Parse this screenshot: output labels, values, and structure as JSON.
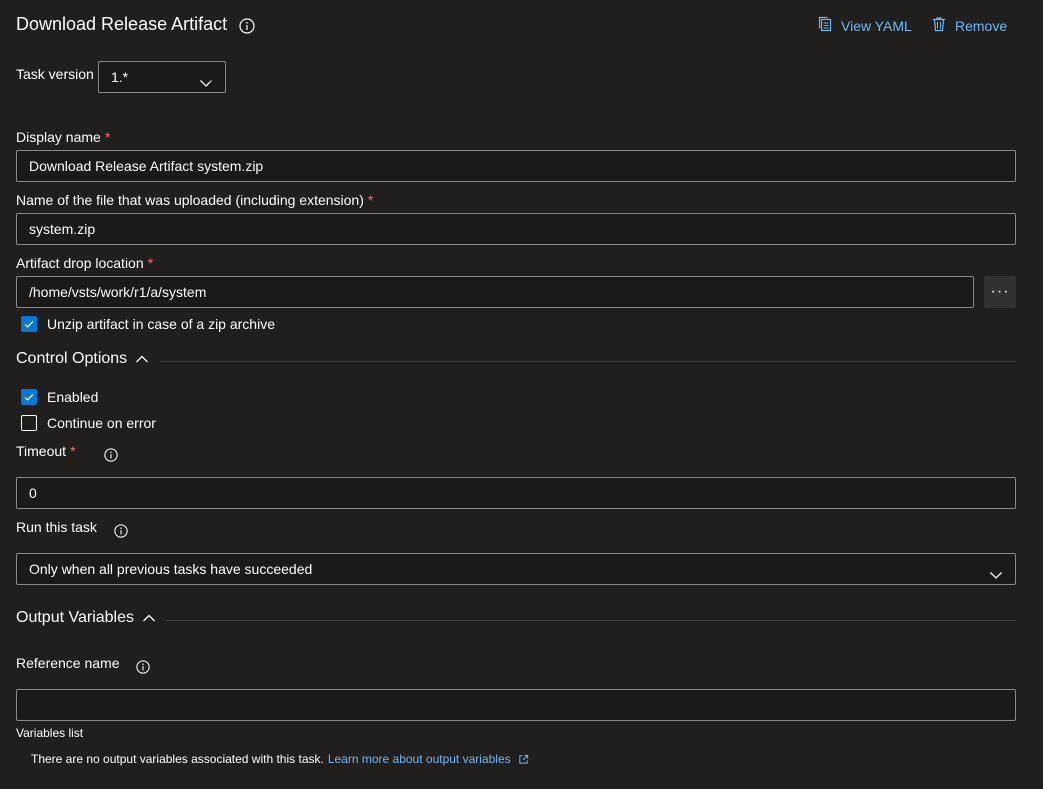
{
  "header": {
    "title": "Download Release Artifact",
    "view_yaml_label": "View YAML",
    "remove_label": "Remove"
  },
  "task_version": {
    "label": "Task version",
    "value": "1.*"
  },
  "display_name": {
    "label": "Display name",
    "required_mark": "*",
    "value": "Download Release Artifact system.zip"
  },
  "file_name": {
    "label": "Name of the file that was uploaded (including extension)",
    "required_mark": "*",
    "value": "system.zip"
  },
  "drop_location": {
    "label": "Artifact drop location",
    "required_mark": "*",
    "value": "/home/vsts/work/r1/a/system",
    "browse_label": "···"
  },
  "unzip": {
    "label": "Unzip artifact in case of a zip archive",
    "checked": true
  },
  "control_options": {
    "title": "Control Options",
    "enabled": {
      "label": "Enabled",
      "checked": true
    },
    "continue_on_error": {
      "label": "Continue on error",
      "checked": false
    },
    "timeout": {
      "label": "Timeout",
      "required_mark": "*",
      "value": "0"
    },
    "run_this_task": {
      "label": "Run this task",
      "value": "Only when all previous tasks have succeeded"
    }
  },
  "output_variables": {
    "title": "Output Variables",
    "reference_name": {
      "label": "Reference name",
      "value": ""
    },
    "variables_list_label": "Variables list",
    "empty_message": "There are no output variables associated with this task.",
    "learn_more_link": "Learn more about output variables"
  },
  "colors": {
    "background": "#201f1e",
    "accent": "#0078d4",
    "link": "#6cb8f6",
    "required": "#f1707b"
  },
  "icons": [
    "info-icon",
    "copy-icon",
    "trash-icon",
    "chevron-down-icon",
    "chevron-up-icon",
    "check-icon",
    "external-link-icon"
  ]
}
